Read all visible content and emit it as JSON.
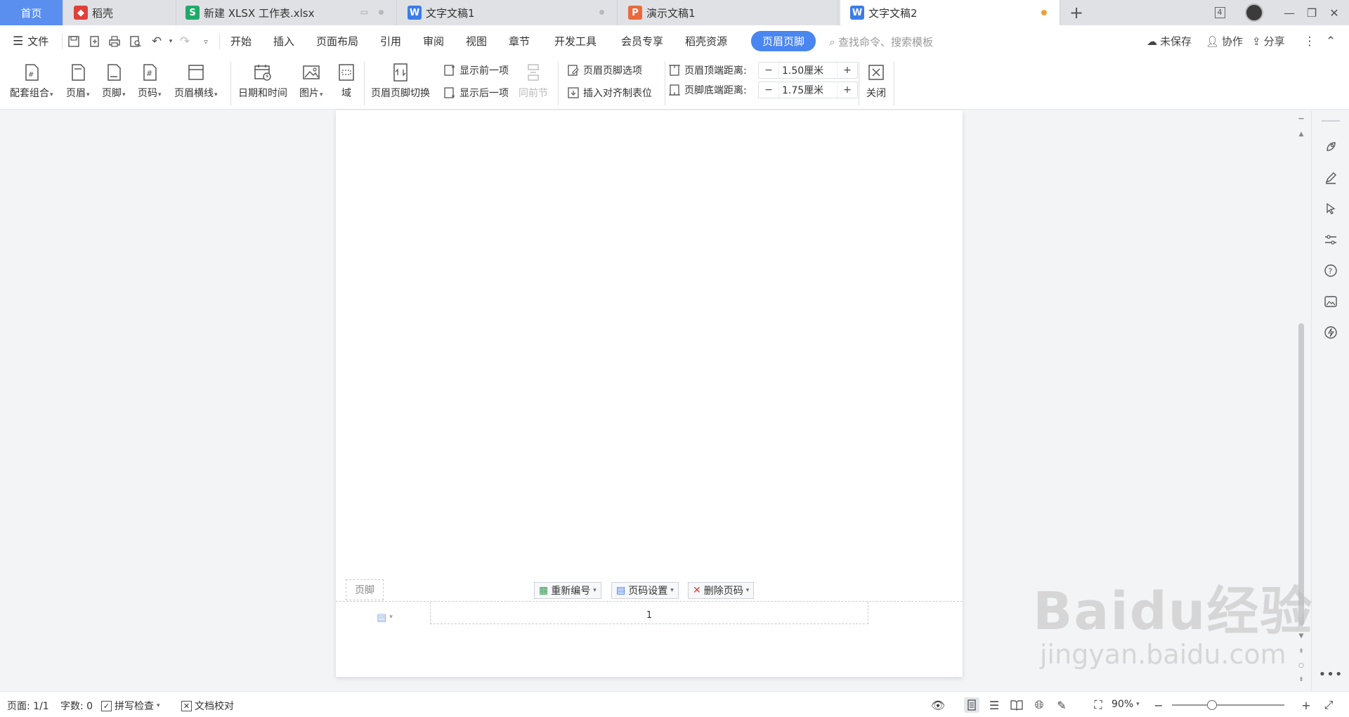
{
  "tabs": [
    {
      "label": "首页"
    },
    {
      "label": "稻壳"
    },
    {
      "label": "新建 XLSX 工作表.xlsx"
    },
    {
      "label": "文字文稿1"
    },
    {
      "label": "演示文稿1"
    },
    {
      "label": "文字文稿2"
    }
  ],
  "window": {
    "window_count": "4"
  },
  "menu": {
    "file": "文件",
    "items": [
      "开始",
      "插入",
      "页面布局",
      "引用",
      "审阅",
      "视图",
      "章节",
      "开发工具",
      "会员专享",
      "稻壳资源",
      "页眉页脚"
    ],
    "search_placeholder": "查找命令、搜索模板",
    "unsaved": "未保存",
    "collab": "协作",
    "share": "分享"
  },
  "ribbon": {
    "combo": "配套组合",
    "header": "页眉",
    "footer": "页脚",
    "page_number": "页码",
    "header_line": "页眉横线",
    "datetime": "日期和时间",
    "picture": "图片",
    "field": "域",
    "switch": "页眉页脚切换",
    "show_prev": "显示前一项",
    "show_next": "显示后一项",
    "same_prev": "同前节",
    "options": "页眉页脚选项",
    "insert_tab": "插入对齐制表位",
    "top_dist_label": "页眉顶端距离:",
    "top_dist_value": "1.50厘米",
    "bottom_dist_label": "页脚底端距离:",
    "bottom_dist_value": "1.75厘米",
    "close": "关闭"
  },
  "document": {
    "footer_tag": "页脚",
    "renumber": "重新编号",
    "page_setting": "页码设置",
    "delete_number": "删除页码",
    "page_number_value": "1"
  },
  "status": {
    "page": "页面: 1/1",
    "words": "字数: 0",
    "spell": "拼写检查",
    "proof": "文档校对",
    "zoom": "90%",
    "zoom_level_percent": 90
  },
  "watermark": {
    "line1": "Baidu经验",
    "line2": "jingyan.baidu.com"
  },
  "colors": {
    "accent": "#4a86f0",
    "home_tab": "#5a8ff0",
    "unsaved_dot": "#e6a23c"
  }
}
